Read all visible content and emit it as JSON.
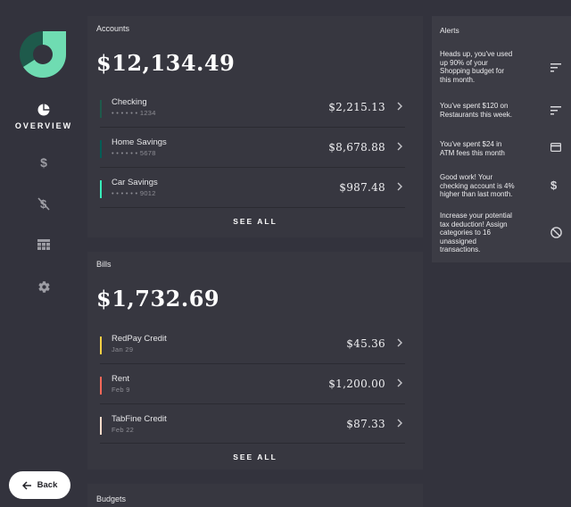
{
  "nav": {
    "overview_label": "OVERVIEW"
  },
  "accounts": {
    "title": "Accounts",
    "total": "$12,134.49",
    "items": [
      {
        "name": "Checking",
        "sub": "• • • • • • 1234",
        "amount": "$2,215.13",
        "color": "#1e5a4b"
      },
      {
        "name": "Home Savings",
        "sub": "• • • • • • 5678",
        "amount": "$8,678.88",
        "color": "#045d56"
      },
      {
        "name": "Car Savings",
        "sub": "• • • • • • 9012",
        "amount": "$987.48",
        "color": "#37efba"
      }
    ],
    "see_all": "SEE ALL"
  },
  "bills": {
    "title": "Bills",
    "total": "$1,732.69",
    "items": [
      {
        "name": "RedPay Credit",
        "sub": "Jan 29",
        "amount": "$45.36",
        "color": "#ffcf44"
      },
      {
        "name": "Rent",
        "sub": "Feb 9",
        "amount": "$1,200.00",
        "color": "#ff6859"
      },
      {
        "name": "TabFine Credit",
        "sub": "Feb 22",
        "amount": "$87.33",
        "color": "#ffdccb"
      }
    ],
    "see_all": "SEE ALL"
  },
  "budgets": {
    "title": "Budgets"
  },
  "alerts": {
    "title": "Alerts",
    "items": [
      {
        "text": "Heads up, you've used up 90% of your Shopping budget for this month.",
        "icon": "sort-icon"
      },
      {
        "text": "You've spent $120 on Restaurants this week.",
        "icon": "sort-icon"
      },
      {
        "text": "You've spent $24 in ATM fees this month",
        "icon": "credit-card-icon"
      },
      {
        "text": "Good work! Your checking account is 4% higher than last month.",
        "icon": "dollar-icon"
      },
      {
        "text": "Increase your potential tax deduction! Assign categories to 16 unassigned transactions.",
        "icon": "not-interested-icon"
      }
    ]
  },
  "back_button": {
    "label": "Back"
  },
  "colors": {
    "background": "#33333d",
    "panel": "#373740",
    "logo_dark": "#1e5a4b",
    "logo_light": "#6fdcb2"
  }
}
